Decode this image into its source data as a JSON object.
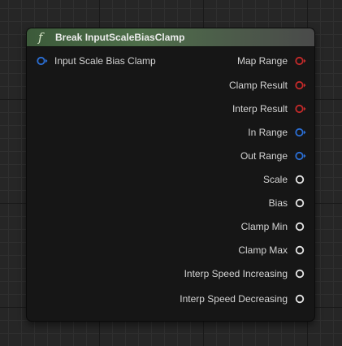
{
  "node": {
    "title": "Break InputScaleBiasClamp",
    "icon": "function-icon",
    "input_pins": [
      {
        "label": "Input Scale Bias Clamp",
        "color": "#2b6fd6",
        "kind": "struct"
      }
    ],
    "output_pins": [
      {
        "label": "Map Range",
        "color": "#c42a2a",
        "kind": "struct"
      },
      {
        "label": "Clamp Result",
        "color": "#c42a2a",
        "kind": "struct"
      },
      {
        "label": "Interp Result",
        "color": "#c42a2a",
        "kind": "struct"
      },
      {
        "label": "In Range",
        "color": "#2b6fd6",
        "kind": "struct"
      },
      {
        "label": "Out Range",
        "color": "#2b6fd6",
        "kind": "struct"
      },
      {
        "label": "Scale",
        "color": "#e6e6e6",
        "kind": "float"
      },
      {
        "label": "Bias",
        "color": "#e6e6e6",
        "kind": "float"
      },
      {
        "label": "Clamp Min",
        "color": "#e6e6e6",
        "kind": "float"
      },
      {
        "label": "Clamp Max",
        "color": "#e6e6e6",
        "kind": "float"
      },
      {
        "label": "Interp Speed Increasing",
        "color": "#e6e6e6",
        "kind": "float"
      },
      {
        "label": "Interp Speed Decreasing",
        "color": "#e6e6e6",
        "kind": "float"
      }
    ]
  }
}
